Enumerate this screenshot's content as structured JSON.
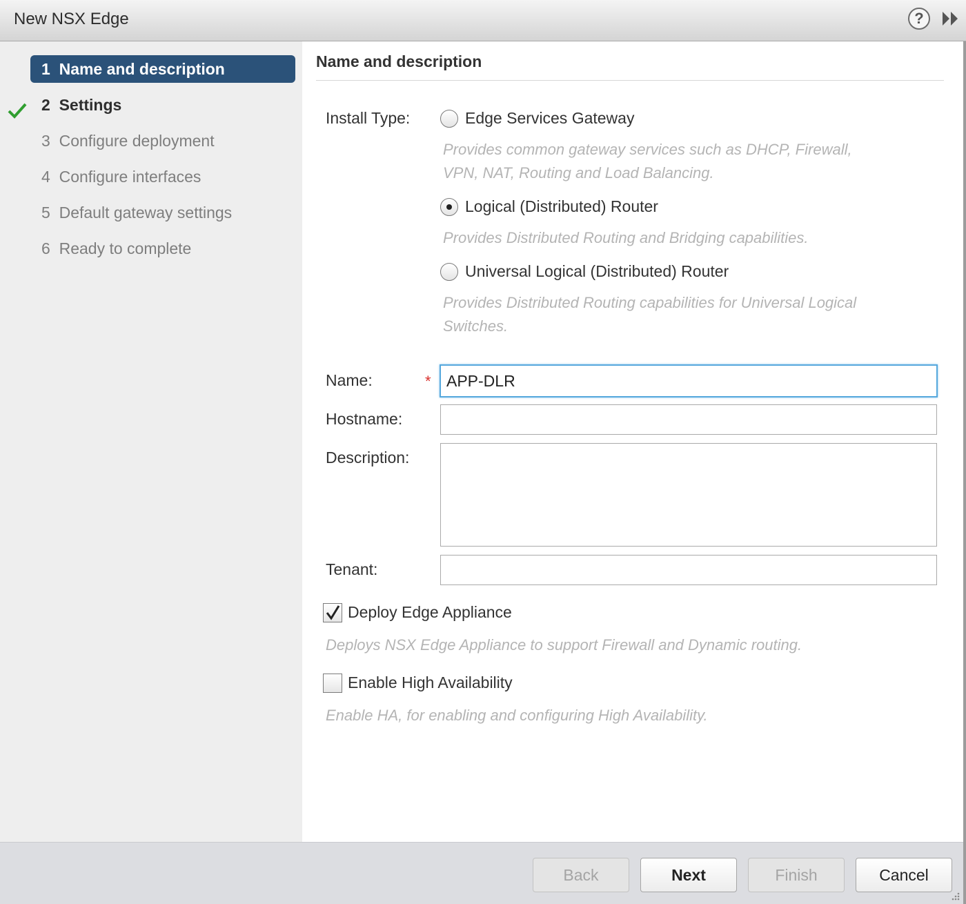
{
  "window": {
    "title": "New NSX Edge",
    "help_symbol": "?"
  },
  "steps": [
    {
      "number": "1",
      "label": "Name and description"
    },
    {
      "number": "2",
      "label": "Settings"
    },
    {
      "number": "3",
      "label": "Configure deployment"
    },
    {
      "number": "4",
      "label": "Configure interfaces"
    },
    {
      "number": "5",
      "label": "Default gateway settings"
    },
    {
      "number": "6",
      "label": "Ready to complete"
    }
  ],
  "form": {
    "section_title": "Name and description",
    "install_type_label": "Install Type:",
    "install_options": [
      {
        "label": "Edge Services Gateway",
        "description_line1": "Provides common gateway services such as DHCP, Firewall,",
        "description_line2": "VPN, NAT, Routing and Load Balancing.",
        "selected": false
      },
      {
        "label": "Logical (Distributed) Router",
        "description_line1": "Provides Distributed Routing and Bridging  capabilities.",
        "selected": true
      },
      {
        "label": "Universal Logical (Distributed) Router",
        "description_line1": "Provides Distributed Routing capabilities for Universal Logical",
        "description_line2": "Switches.",
        "selected": false
      }
    ],
    "name_label": "Name:",
    "required_marker": "*",
    "name_value": "APP-DLR",
    "hostname_label": "Hostname:",
    "hostname_value": "",
    "description_label": "Description:",
    "description_value": "",
    "tenant_label": "Tenant:",
    "tenant_value": "",
    "deploy_label": "Deploy Edge Appliance",
    "deploy_checked": true,
    "deploy_hint": "Deploys NSX Edge Appliance to support Firewall and Dynamic routing.",
    "ha_label": "Enable High Availability",
    "ha_checked": false,
    "ha_hint": "Enable HA, for enabling and configuring High Availability."
  },
  "footer": {
    "back": "Back",
    "next": "Next",
    "finish": "Finish",
    "cancel": "Cancel"
  },
  "colors": {
    "active_step": "#2b5279",
    "check": "#2f9e2f",
    "required": "#d9302c",
    "focus_border": "#56a8dd"
  }
}
